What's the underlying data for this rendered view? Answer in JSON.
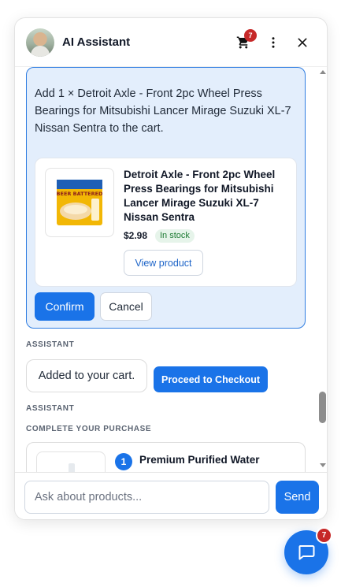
{
  "header": {
    "title": "AI Assistant",
    "cart_count": "7",
    "avatar_icon": "user-avatar",
    "cart_icon": "cart-icon",
    "more_icon": "more-vertical-icon",
    "close_icon": "close-icon"
  },
  "confirmation": {
    "message": "Add 1 × Detroit Axle - Front 2pc Wheel Press Bearings for Mitsubishi Lancer Mirage Suzuki XL-7 Nissan Sentra to the cart.",
    "product": {
      "name": "Detroit Axle - Front 2pc Wheel Press Bearings for Mitsubishi Lancer Mirage Suzuki XL-7 Nissan Sentra",
      "price": "$2.98",
      "stock": "In stock",
      "image_text": "BEER BATTERED",
      "view_label": "View product"
    },
    "confirm_label": "Confirm",
    "cancel_label": "Cancel"
  },
  "messages": [
    {
      "role": "ASSISTANT",
      "text": "Added to your cart.",
      "action_label": "Proceed to Checkout"
    },
    {
      "role": "ASSISTANT",
      "section_title": "COMPLETE YOUR PURCHASE",
      "items": [
        {
          "step": "1",
          "name": "Premium Purified Water"
        }
      ]
    }
  ],
  "footer": {
    "input_value": "",
    "input_placeholder": "Ask about products...",
    "send_label": "Send"
  },
  "launcher": {
    "badge_count": "7",
    "icon": "chat-bubble-icon"
  },
  "colors": {
    "accent": "#1a73e8",
    "confirm_bg": "#e3eefc",
    "badge": "#c62828",
    "in_stock_bg": "#e6f4ea",
    "in_stock_text": "#1e7b34"
  }
}
